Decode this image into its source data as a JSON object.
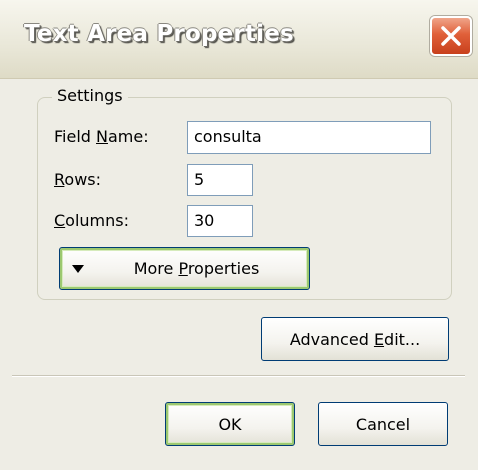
{
  "window": {
    "title": "Text Area Properties",
    "close_icon": "close-x-icon"
  },
  "settings": {
    "legend": "Settings",
    "field_name": {
      "label_pre": "Field ",
      "label_u": "N",
      "label_post": "ame:",
      "value": "consulta"
    },
    "rows": {
      "label_u": "R",
      "label_post": "ows:",
      "value": "5"
    },
    "columns": {
      "label_u": "C",
      "label_post": "olumns:",
      "value": "30"
    },
    "more_properties": {
      "icon": "triangle-down-icon",
      "label_pre": "More ",
      "label_u": "P",
      "label_post": "roperties"
    }
  },
  "buttons": {
    "advanced_edit": {
      "label_pre": "Advanced ",
      "label_u": "E",
      "label_post": "dit..."
    },
    "ok": "OK",
    "cancel": "Cancel"
  },
  "colors": {
    "dialog_bg": "#eeede5",
    "close_button": "#e0603a",
    "default_button_glow": "#9cc870",
    "field_border": "#7f9db9"
  }
}
